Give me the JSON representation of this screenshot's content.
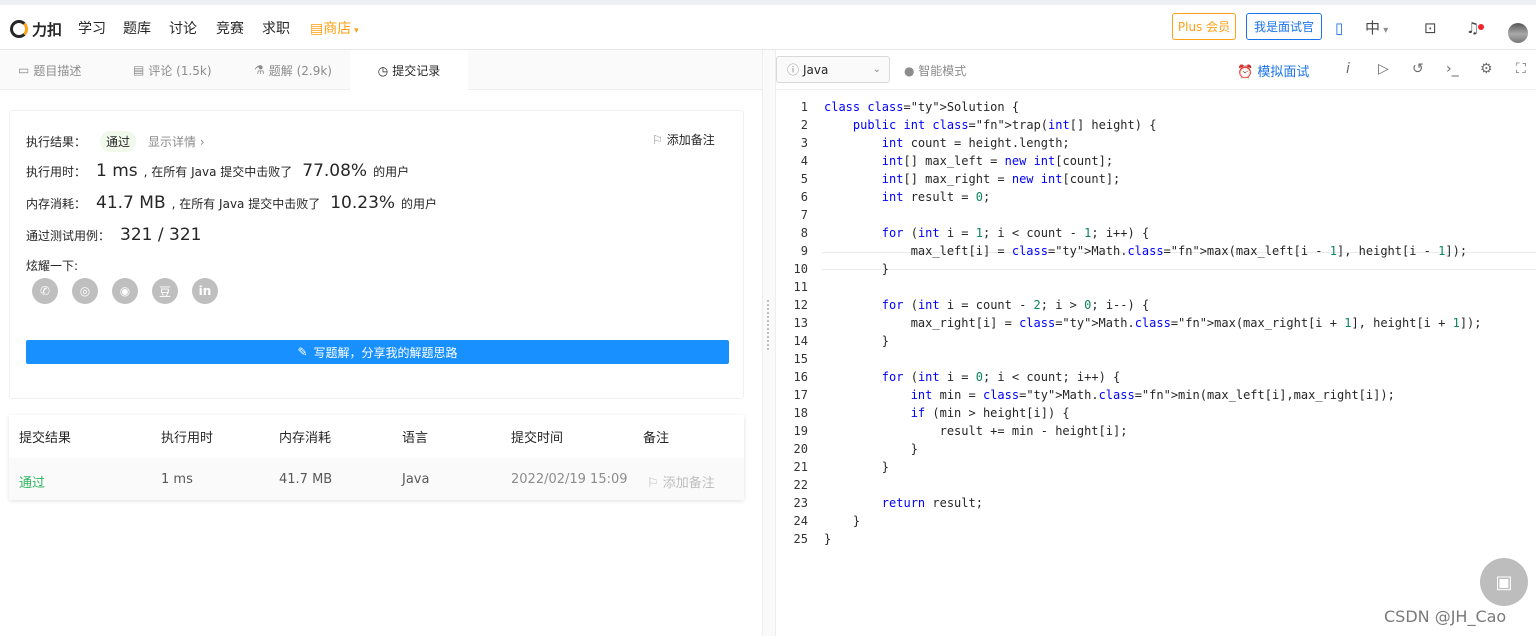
{
  "header": {
    "logo": "力扣",
    "nav": [
      "学习",
      "题库",
      "讨论",
      "竞赛",
      "求职"
    ],
    "store": "商店",
    "plus": "Plus 会员",
    "interviewer": "我是面试官",
    "lang": "中"
  },
  "tabs": [
    {
      "label": "题目描述",
      "icon": "doc-icon"
    },
    {
      "label": "评论 (1.5k)",
      "icon": "comment-icon"
    },
    {
      "label": "题解 (2.9k)",
      "icon": "flask-icon"
    },
    {
      "label": "提交记录",
      "icon": "clock-icon"
    }
  ],
  "result": {
    "status_label": "执行结果：",
    "status": "通过",
    "detail": "显示详情 ›",
    "add_note": "添加备注",
    "time_label": "执行用时：",
    "time_value": "1 ms",
    "time_text": ", 在所有 Java 提交中击败了",
    "time_pct": "77.08%",
    "users": "的用户",
    "mem_label": "内存消耗：",
    "mem_value": "41.7 MB",
    "mem_text": ", 在所有 Java 提交中击败了",
    "mem_pct": "10.23%",
    "cases_label": "通过测试用例：",
    "cases": "321 / 321",
    "share": "炫耀一下:",
    "social": [
      "wechat-icon",
      "weibo-icon",
      "qq-icon",
      "douban-icon",
      "linkedin-icon"
    ],
    "social_glyphs": [
      "✆",
      "◎",
      "◉",
      "豆",
      "in"
    ],
    "write_btn": "写题解，分享我的解题思路"
  },
  "table": {
    "headers": [
      "提交结果",
      "执行用时",
      "内存消耗",
      "语言",
      "提交时间",
      "备注"
    ],
    "row": {
      "status": "通过",
      "time": "1 ms",
      "mem": "41.7 MB",
      "lang": "Java",
      "date": "2022/02/19 15:09",
      "note": "添加备注"
    }
  },
  "editor": {
    "language": "Java",
    "smart": "智能模式",
    "mock": "模拟面试"
  },
  "code": [
    "class Solution {",
    "    public int trap(int[] height) {",
    "        int count = height.length;",
    "        int[] max_left = new int[count];",
    "        int[] max_right = new int[count];",
    "        int result = 0;",
    "",
    "        for (int i = 1; i < count - 1; i++) {",
    "            max_left[i] = Math.max(max_left[i - 1], height[i - 1]);",
    "        }",
    "",
    "        for (int i = count - 2; i > 0; i--) {",
    "            max_right[i] = Math.max(max_right[i + 1], height[i + 1]);",
    "        }",
    "",
    "        for (int i = 0; i < count; i++) {",
    "            int min = Math.min(max_left[i],max_right[i]);",
    "            if (min > height[i]) {",
    "                result += min - height[i];",
    "            }",
    "        }",
    "",
    "        return result;",
    "    }",
    "}"
  ],
  "watermark": "CSDN @JH_Cao",
  "colors": {
    "accent": "#1890ff",
    "success": "#2db55d",
    "orange": "#ffa116"
  }
}
